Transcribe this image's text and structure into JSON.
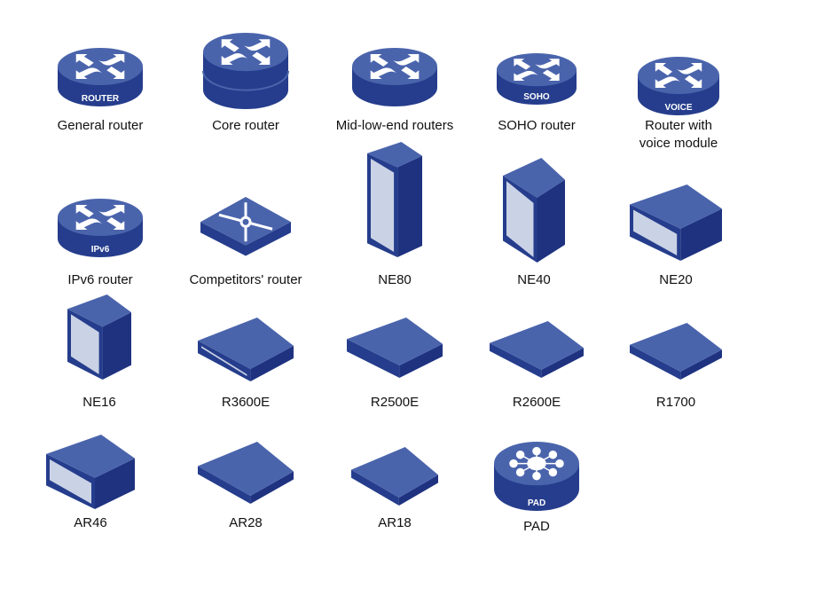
{
  "colors": {
    "top": "#4a64ac",
    "side": "#253d8c",
    "side_dark": "#1e3280",
    "glyph": "#ffffff",
    "text": "#111111"
  },
  "items": [
    {
      "label": "General router",
      "badge": "ROUTER",
      "icon": "router-icon"
    },
    {
      "label": "Core router",
      "icon": "core-router-icon"
    },
    {
      "label": "Mid-low-end routers",
      "icon": "router-icon"
    },
    {
      "label": "SOHO router",
      "badge": "SOHO",
      "icon": "router-icon"
    },
    {
      "label": "Router with voice module",
      "label_line1": "Router with",
      "label_line2": "voice module",
      "badge": "VOICE",
      "icon": "router-icon"
    },
    {
      "label": "IPv6 router",
      "badge": "IPv6",
      "icon": "router-icon"
    },
    {
      "label": "Competitors' router",
      "icon": "competitor-router-icon"
    },
    {
      "label": "NE80",
      "icon": "tall-chassis-icon"
    },
    {
      "label": "NE40",
      "icon": "chassis-icon"
    },
    {
      "label": "NE20",
      "icon": "rack-box-icon"
    },
    {
      "label": "NE16",
      "icon": "chassis-icon"
    },
    {
      "label": "R3600E",
      "icon": "flat-box-icon"
    },
    {
      "label": "R2500E",
      "icon": "flat-box-icon"
    },
    {
      "label": "R2600E",
      "icon": "flat-box-icon"
    },
    {
      "label": "R1700",
      "icon": "modem-icon"
    },
    {
      "label": "AR46",
      "icon": "rack-box-icon"
    },
    {
      "label": "AR28",
      "icon": "flat-box-icon"
    },
    {
      "label": "AR18",
      "icon": "modem-icon"
    },
    {
      "label": "PAD",
      "badge": "PAD",
      "icon": "pad-icon"
    }
  ]
}
